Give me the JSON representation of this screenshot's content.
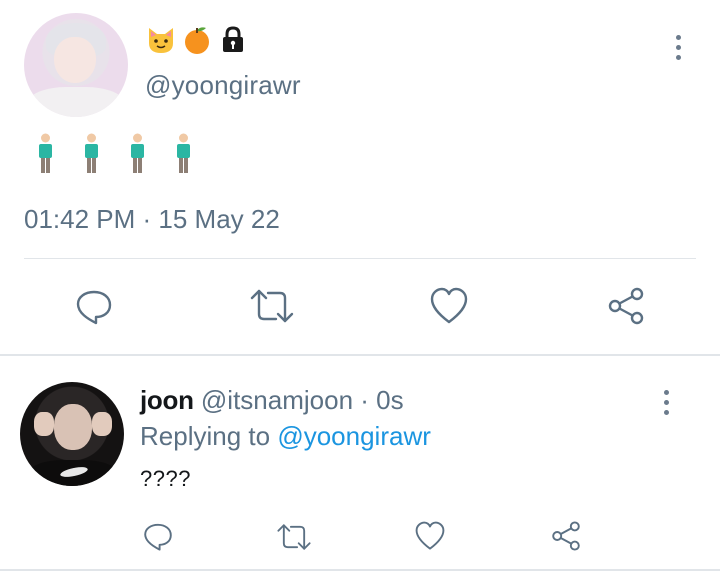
{
  "main_tweet": {
    "name_emojis": [
      "cat-face",
      "tangerine",
      "lock"
    ],
    "handle": "@yoongirawr",
    "body_emoji_count": 4,
    "timestamp": "01:42 PM · 15 May 22",
    "actions": [
      "reply-icon",
      "retweet-icon",
      "like-icon",
      "share-icon"
    ]
  },
  "reply": {
    "name": "joon",
    "handle_time": "@itsnamjoon · 0s",
    "replying_to_label": "Replying to",
    "replying_to_handle": "@yoongirawr",
    "text": "????",
    "actions": [
      "reply-icon",
      "retweet-icon",
      "like-icon",
      "share-icon"
    ]
  },
  "colors": {
    "secondary_text": "#5b7083",
    "link": "#1b95e0",
    "divider": "#e1e5e9"
  }
}
